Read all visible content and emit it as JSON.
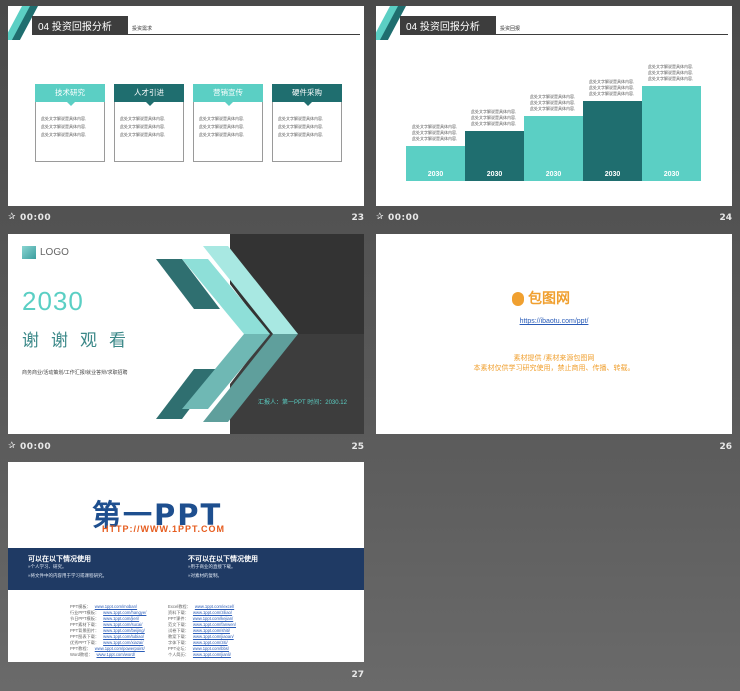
{
  "slides": [
    {
      "number": "23",
      "time": "00:00",
      "star": "✰",
      "header_title": "04 投资回报分析",
      "header_sub": "投资需求",
      "cards": [
        {
          "title": "技术研究",
          "color": "#5bcfc4",
          "text": [
            "此处文字解说是具体内容,",
            "此处文字解说是具体内容,",
            "此处文字解说是具体内容,"
          ]
        },
        {
          "title": "人才引进",
          "color": "#1f6e6f",
          "text": [
            "此处文字解说是具体内容,",
            "此处文字解说是具体内容,",
            "此处文字解说是具体内容,"
          ]
        },
        {
          "title": "营销宣传",
          "color": "#5bcfc4",
          "text": [
            "此处文字解说是具体内容,",
            "此处文字解说是具体内容,",
            "此处文字解说是具体内容,"
          ]
        },
        {
          "title": "硬件采购",
          "color": "#1f6e6f",
          "text": [
            "此处文字解说是具体内容,",
            "此处文字解说是具体内容,",
            "此处文字解说是具体内容,"
          ]
        }
      ]
    },
    {
      "number": "24",
      "time": "00:00",
      "star": "✰",
      "header_title": "04 投资回报分析",
      "header_sub": "投资回报",
      "bars": [
        {
          "label": "2030",
          "level": 1,
          "color": "#5bcfc4",
          "text": [
            "此处文字解说是具体内容,",
            "此处文字解说是具体内容,",
            "此处文字解说是具体内容,"
          ]
        },
        {
          "label": "2030",
          "level": 2,
          "color": "#1f6e6f",
          "text": [
            "此处文字解说是具体内容,",
            "此处文字解说是具体内容,",
            "此处文字解说是具体内容,"
          ]
        },
        {
          "label": "2030",
          "level": 3,
          "color": "#5bcfc4",
          "text": [
            "此处文字解说是具体内容,",
            "此处文字解说是具体内容,",
            "此处文字解说是具体内容,"
          ]
        },
        {
          "label": "2030",
          "level": 4,
          "color": "#1f6e6f",
          "text": [
            "此处文字解说是具体内容,",
            "此处文字解说是具体内容,",
            "此处文字解说是具体内容,"
          ]
        },
        {
          "label": "2030",
          "level": 5,
          "color": "#5bcfc4",
          "text": [
            "此处文字解说是具体内容,",
            "此处文字解说是具体内容,",
            "此处文字解说是具体内容,"
          ]
        }
      ]
    },
    {
      "number": "25",
      "time": "00:00",
      "star": "✰",
      "logo": "LOGO",
      "year": "2030",
      "thanks": "谢谢观看",
      "tags": "商务商业/活动策划/工作汇报/就业答辩/求职招聘",
      "reporter": "汇报人：第一PPT      时间：2030.12"
    },
    {
      "number": "26",
      "logo_text": "包图网",
      "link": "https://ibaotu.com/ppt/",
      "note1": "素材提供 /素材来源包图网",
      "note2": "本素材仅供学习研究使用，禁止商用、传播、转载。"
    },
    {
      "number": "27",
      "brand": "第一PPT",
      "url": "HTTP://WWW.1PPT.COM",
      "can_title": "可以在以下情况使用",
      "can_items": [
        "»个人学习、研究。",
        "»将文件中的内容用于学习或课程研究。"
      ],
      "cannot_title": "不可以在以下情况使用",
      "cannot_items": [
        "»用于商业的直接下载。",
        "»对素材的复制。"
      ],
      "links_left": [
        {
          "name": "PPT模板：",
          "url": "www.1ppt.com/moban/"
        },
        {
          "name": "行业PPT模板：",
          "url": "www.1ppt.com/hangye/"
        },
        {
          "name": "节日PPT模板：",
          "url": "www.1ppt.com/jieri/"
        },
        {
          "name": "PPT素材下载：",
          "url": "www.1ppt.com/sucai/"
        },
        {
          "name": "PPT背景图片：",
          "url": "www.1ppt.com/beijing/"
        },
        {
          "name": "PPT图表下载：",
          "url": "www.1ppt.com/tubiao/"
        },
        {
          "name": "优秀PPT下载：",
          "url": "www.1ppt.com/xiazai/"
        },
        {
          "name": "PPT教程：",
          "url": "www.1ppt.com/powerpoint/"
        },
        {
          "name": "Word教程：",
          "url": "www.1ppt.com/word/"
        }
      ],
      "links_right": [
        {
          "name": "Excel教程：",
          "url": "www.1ppt.com/excel/"
        },
        {
          "name": "资料下载：",
          "url": "www.1ppt.com/ziliao/"
        },
        {
          "name": "PPT课件：",
          "url": "www.1ppt.com/kejian/"
        },
        {
          "name": "范文下载：",
          "url": "www.1ppt.com/fanwen/"
        },
        {
          "name": "试卷下载：",
          "url": "www.1ppt.com/shiti/"
        },
        {
          "name": "教案下载：",
          "url": "www.1ppt.com/jiaoan/"
        },
        {
          "name": "字体下载：",
          "url": "www.1ppt.com/ziti/"
        },
        {
          "name": "PPT论坛：",
          "url": "www.1ppt.com/bbs/"
        },
        {
          "name": "个人简历：",
          "url": "www.1ppt.com/jianli/"
        }
      ]
    }
  ]
}
